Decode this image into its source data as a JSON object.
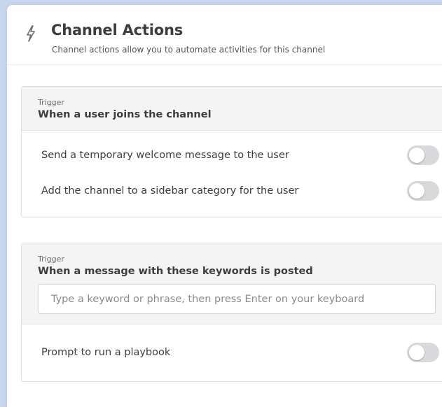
{
  "header": {
    "title": "Channel Actions",
    "subtitle": "Channel actions allow you to automate activities for this channel",
    "icon": "lightning-bolt-icon"
  },
  "cards": [
    {
      "trigger_label": "Trigger",
      "trigger_title": "When a user joins the channel",
      "actions": [
        {
          "label": "Send a temporary welcome message to the user",
          "enabled": false
        },
        {
          "label": "Add the channel to a sidebar category for the user",
          "enabled": false
        }
      ]
    },
    {
      "trigger_label": "Trigger",
      "trigger_title": "When a message with these keywords is posted",
      "keyword_input": {
        "value": "",
        "placeholder": "Type a keyword or phrase, then press Enter on your keyboard"
      },
      "actions": [
        {
          "label": "Prompt to run a playbook",
          "enabled": false
        }
      ]
    }
  ],
  "colors": {
    "background": "#c9d5ec",
    "toggle_off": "#d9d9dc",
    "trigger_bg": "#f4f4f5"
  }
}
